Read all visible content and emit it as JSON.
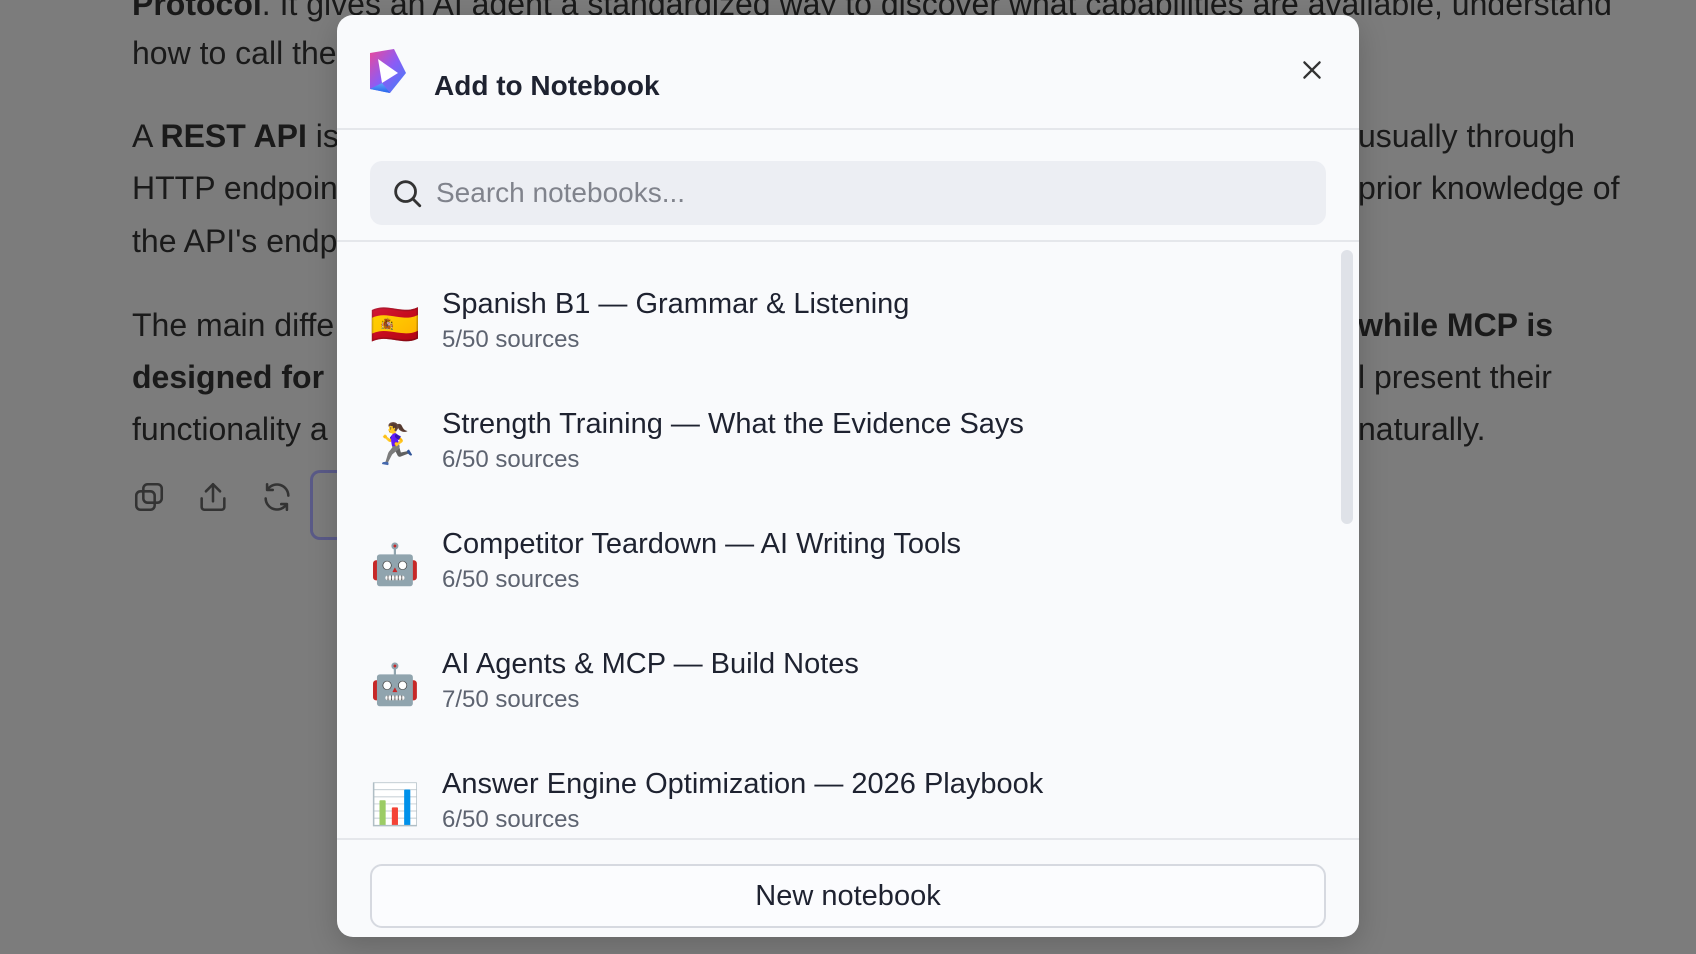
{
  "background": {
    "lines": [
      {
        "parts": [
          {
            "t": "Protocol",
            "b": true
          },
          {
            "t": ". It gives an AI agent a standardized way to discover what capabilities are available, understand",
            "b": false
          }
        ]
      },
      {
        "parts": [
          {
            "t": "how to call the",
            "b": false
          }
        ]
      },
      {
        "parts": [
          {
            "t": "A ",
            "b": false
          },
          {
            "t": "REST API",
            "b": true
          },
          {
            "t": " is",
            "b": false
          }
        ]
      },
      {
        "parts": [
          {
            "t": "HTTP endpoin",
            "b": false
          }
        ]
      },
      {
        "parts": [
          {
            "t": "the API's endp",
            "b": false
          }
        ]
      },
      {
        "parts": [
          {
            "t": "The main diffe",
            "b": false
          }
        ]
      },
      {
        "parts": [
          {
            "t": "designed for ",
            "b": true
          }
        ]
      },
      {
        "parts": [
          {
            "t": "functionality a",
            "b": false
          }
        ]
      },
      {
        "parts": [
          {
            "t": "usually through",
            "b": false
          }
        ]
      },
      {
        "parts": [
          {
            "t": "prior knowledge of",
            "b": false
          }
        ]
      },
      {
        "parts": [
          {
            "t": "while MCP is",
            "b": true
          }
        ]
      },
      {
        "parts": [
          {
            "t": "l present their",
            "b": false
          }
        ]
      },
      {
        "parts": [
          {
            "t": "naturally.",
            "b": false
          }
        ]
      }
    ],
    "icons": [
      "copy-icon",
      "share-icon",
      "refresh-icon"
    ]
  },
  "modal": {
    "title": "Add to Notebook",
    "close_icon": "close-icon",
    "search": {
      "placeholder": "Search notebooks...",
      "value": ""
    },
    "notebooks": [
      {
        "emoji": "🇪🇸",
        "title": "Spanish B1 — Grammar & Listening",
        "sources": "5/50 sources"
      },
      {
        "emoji": "🏃‍♀️",
        "title": "Strength Training — What the Evidence Says",
        "sources": "6/50 sources"
      },
      {
        "emoji": "🤖",
        "title": "Competitor Teardown — AI Writing Tools",
        "sources": "6/50 sources"
      },
      {
        "emoji": "🤖",
        "title": "AI Agents & MCP — Build Notes",
        "sources": "7/50 sources"
      },
      {
        "emoji": "📊",
        "title": "Answer Engine Optimization — 2026 Playbook",
        "sources": "6/50 sources"
      }
    ],
    "new_button_label": "New notebook"
  }
}
